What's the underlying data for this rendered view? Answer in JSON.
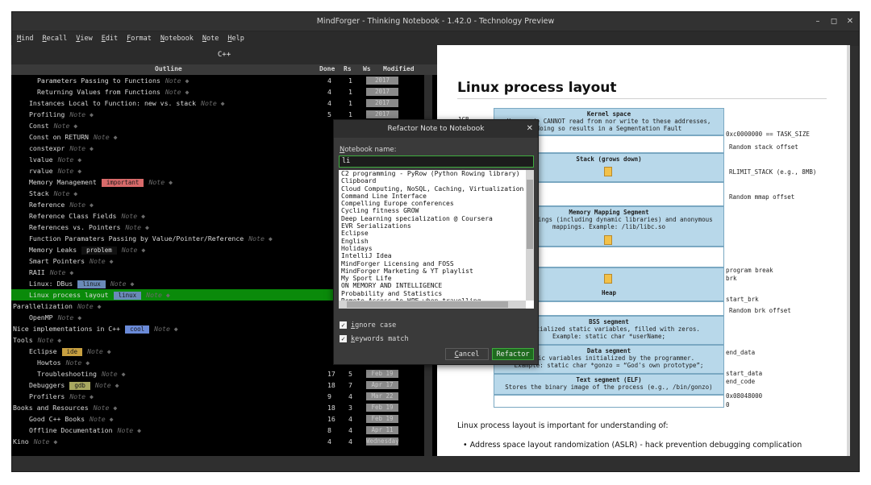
{
  "window": {
    "title": "MindForger - Thinking Notebook - 1.42.0 - Technology Preview",
    "controls": {
      "minimize": "–",
      "maximize": "◻",
      "close": "✕"
    }
  },
  "menu": [
    "Mind",
    "Recall",
    "View",
    "Edit",
    "Format",
    "Notebook",
    "Note",
    "Help"
  ],
  "notebook": {
    "title": "C++",
    "columns": {
      "outline": "Outline",
      "done": "Done",
      "rs": "Rs",
      "ws": "Ws",
      "modified": "Modified"
    },
    "rows": [
      {
        "name": "Parameters Passing to Functions",
        "note": "Note ◆",
        "indent": 3,
        "rs": "4",
        "ws": "1",
        "mod": "2017"
      },
      {
        "name": "Returning Values from Functions",
        "note": "Note ◆",
        "indent": 3,
        "rs": "4",
        "ws": "1",
        "mod": "2017"
      },
      {
        "name": "Instances Local to Function: new vs. stack",
        "note": "Note ◆",
        "indent": 2,
        "rs": "4",
        "ws": "1",
        "mod": "2017"
      },
      {
        "name": "Profiling",
        "note": "Note ◆",
        "indent": 2,
        "rs": "5",
        "ws": "1",
        "mod": "2017"
      },
      {
        "name": "Const",
        "note": "Note ◆",
        "indent": 2,
        "rs": "",
        "ws": "",
        "mod": ""
      },
      {
        "name": "Const on RETURN",
        "note": "Note ◆",
        "indent": 2,
        "rs": "",
        "ws": "",
        "mod": ""
      },
      {
        "name": "constexpr",
        "note": "Note ◆",
        "indent": 2,
        "rs": "",
        "ws": "",
        "mod": ""
      },
      {
        "name": "lvalue",
        "note": "Note ◆",
        "indent": 2,
        "rs": "",
        "ws": "",
        "mod": ""
      },
      {
        "name": "rvalue",
        "note": "Note ◆",
        "indent": 2,
        "rs": "",
        "ws": "",
        "mod": ""
      },
      {
        "name": "Memory Management",
        "note": "Note ◆",
        "indent": 2,
        "tag": "important",
        "tagColor": "#d86a6a",
        "rs": "",
        "ws": "",
        "mod": ""
      },
      {
        "name": "Stack",
        "note": "Note ◆",
        "indent": 2,
        "rs": "",
        "ws": "",
        "mod": ""
      },
      {
        "name": "Reference",
        "note": "Note ◆",
        "indent": 2,
        "rs": "",
        "ws": "",
        "mod": ""
      },
      {
        "name": "Reference Class Fields",
        "note": "Note ◆",
        "indent": 2,
        "rs": "",
        "ws": "",
        "mod": ""
      },
      {
        "name": "References vs. Pointers",
        "note": "Note ◆",
        "indent": 2,
        "rs": "",
        "ws": "",
        "mod": ""
      },
      {
        "name": "Function Paramaters Passing by Value/Pointer/Reference",
        "note": "Note ◆",
        "indent": 2,
        "rs": "",
        "ws": "",
        "mod": ""
      },
      {
        "name": "Memory Leaks",
        "note": "Note ◆",
        "indent": 2,
        "tag": "problem",
        "tagColor": "#111111",
        "tagText": "#e0e0e0",
        "rs": "",
        "ws": "",
        "mod": ""
      },
      {
        "name": "Smart Pointers",
        "note": "Note ◆",
        "indent": 2,
        "rs": "",
        "ws": "",
        "mod": ""
      },
      {
        "name": "RAII",
        "note": "Note ◆",
        "indent": 2,
        "rs": "",
        "ws": "",
        "mod": ""
      },
      {
        "name": "Linux: DBus",
        "note": "Note ◆",
        "indent": 2,
        "tag": "linux",
        "tagColor": "#6a8ab8",
        "rs": "",
        "ws": "",
        "mod": ""
      },
      {
        "name": "Linux process layout",
        "note": "Note ◆",
        "indent": 2,
        "tag": "linux",
        "tagColor": "#6a8ab8",
        "sel": true,
        "rs": "",
        "ws": "",
        "mod": ""
      },
      {
        "name": "Parallelization",
        "note": "Note ◆",
        "indent": 0,
        "rs": "",
        "ws": "",
        "mod": ""
      },
      {
        "name": "OpenMP",
        "note": "Note ◆",
        "indent": 2,
        "rs": "",
        "ws": "",
        "mod": ""
      },
      {
        "name": "Nice implementations in C++",
        "note": "Note ◆",
        "indent": 0,
        "tag": "cool",
        "tagColor": "#6a8ad8",
        "rs": "",
        "ws": "",
        "mod": ""
      },
      {
        "name": "Tools",
        "note": "Note ◆",
        "indent": 0,
        "rs": "",
        "ws": "",
        "mod": ""
      },
      {
        "name": "Eclipse",
        "note": "Note ◆",
        "indent": 2,
        "tag": "ide",
        "tagColor": "#c8a040",
        "rs": "",
        "ws": "",
        "mod": ""
      },
      {
        "name": "Howtos",
        "note": "Note ◆",
        "indent": 3,
        "rs": "",
        "ws": "",
        "mod": ""
      },
      {
        "name": "Troubleshooting",
        "note": "Note ◆",
        "indent": 3,
        "rs": "17",
        "ws": "5",
        "mod": "Feb 19"
      },
      {
        "name": "Debuggers",
        "note": "Note ◆",
        "indent": 2,
        "tag": "gdb",
        "tagColor": "#a8a860",
        "rs": "18",
        "ws": "7",
        "mod": "Apr 17"
      },
      {
        "name": "Profilers",
        "note": "Note ◆",
        "indent": 2,
        "rs": "9",
        "ws": "4",
        "mod": "Mar 22"
      },
      {
        "name": "Books and Resources",
        "note": "Note ◆",
        "indent": 0,
        "rs": "18",
        "ws": "3",
        "mod": "Feb 19"
      },
      {
        "name": "Good C++ Books",
        "note": "Note ◆",
        "indent": 2,
        "rs": "16",
        "ws": "4",
        "mod": "Feb 19"
      },
      {
        "name": "Offline Documentation",
        "note": "Note ◆",
        "indent": 2,
        "rs": "8",
        "ws": "4",
        "mod": "Apr 11"
      },
      {
        "name": "Kino",
        "note": "Note ◆",
        "indent": 0,
        "rs": "4",
        "ws": "4",
        "mod": "Wednesday"
      }
    ]
  },
  "viewer": {
    "heading": "Linux process layout",
    "diagram": {
      "kernel_title": "Kernel space",
      "kernel_text1": "User code CANNOT read from nor write to these addresses,",
      "kernel_text2": "doing so results in a Segmentation Fault",
      "stack_title": "Stack (grows down)",
      "mmap_title": "Memory Mapping Segment",
      "mmap_text1": "File mappings (including dynamic libraries) and anonymous",
      "mmap_text2": "mappings. Example: /lib/libc.so",
      "heap_title": "Heap",
      "bss_title": "BSS segment",
      "bss_text1": "Uninitialized static variables, filled with zeros.",
      "bss_text2": "Example: static char *userName;",
      "data_title": "Data segment",
      "data_text1": "Static variables initialized by the programmer.",
      "data_text2": "Example: static char *gonzo = “God's own prototype”;",
      "text_title": "Text segment (ELF)",
      "text_text1": "Stores the binary image of the process (e.g., /bin/gonzo)",
      "lbl_1gb": "1GB",
      "lbl_task": "0xc0000000 == TASK_SIZE",
      "lbl_rso": "Random stack offset",
      "lbl_rlimit": "RLIMIT_STACK (e.g., 8MB)",
      "lbl_rmo": "Random mmap offset",
      "lbl_pb": "program break",
      "lbl_brk": "brk",
      "lbl_startbrk": "start_brk",
      "lbl_rbo": "Random brk offset",
      "lbl_enddata": "end_data",
      "lbl_startdata": "start_data",
      "lbl_endcode": "end_code",
      "lbl_addr": "0x08048000",
      "lbl_zero": "0"
    },
    "paragraph": "Linux process layout is important for understanding of:",
    "bullet": "Address space layout randomization (ASLR) - hack prevention debugging complication"
  },
  "dialog": {
    "title": "Refactor Note to Notebook",
    "close": "✕",
    "label_prefix": "N",
    "label_rest": "otebook name:",
    "input_value": "li",
    "items": [
      "C2 programming - PyRow (Python Rowing library)",
      "Clipboard",
      "Cloud Computing, NoSQL, Caching, Virtualization,",
      "Command Line Interface",
      "Compelling Europe conferences",
      "Cycling fitness GROW",
      "Deep Learning specialization @ Coursera",
      "EVR Serializations",
      "Eclipse",
      "English",
      "Holidays",
      "IntelliJ Idea",
      "MindForger Licensing and FOSS",
      "MindForger Marketing & YT playlist",
      "My Sport Life",
      "ON MEMORY AND INTELLIGENCE",
      "Probability and Statistics",
      "Remote Access to HPE when travelling"
    ],
    "ignore_case_prefix": "i",
    "ignore_case_rest": "gnore case",
    "keywords_prefix": "k",
    "keywords_rest": "eywords match",
    "check_mark": "✓",
    "cancel_prefix": "C",
    "cancel_rest": "ancel",
    "refactor": "Refactor"
  }
}
